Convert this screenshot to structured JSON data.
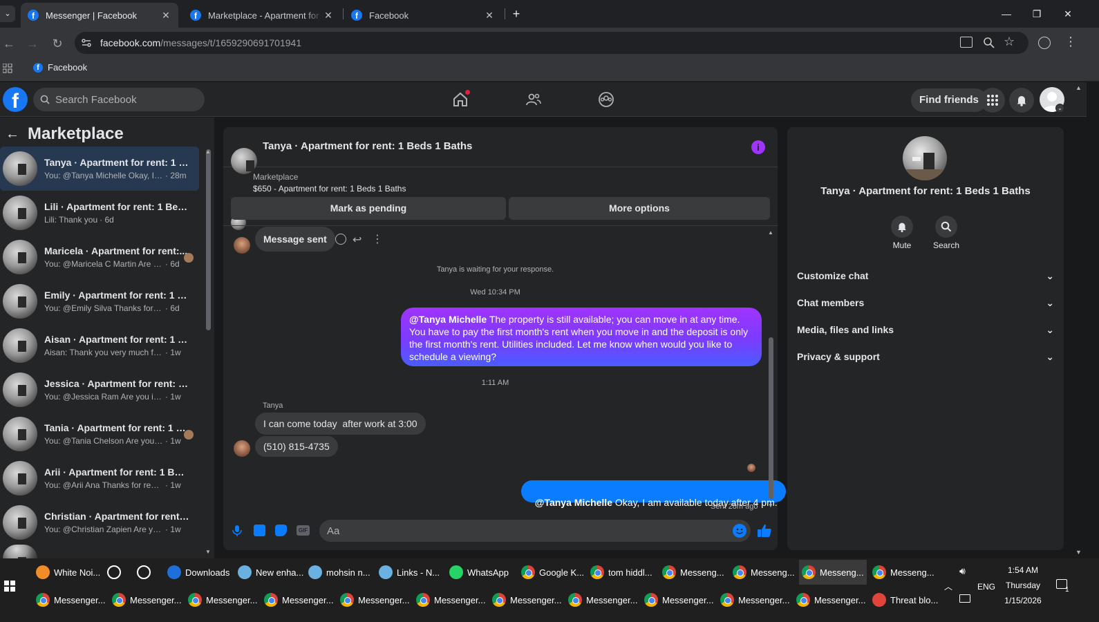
{
  "browser": {
    "tabs": [
      {
        "title": "Messenger | Facebook"
      },
      {
        "title": "Marketplace - Apartment for re"
      },
      {
        "title": "Facebook"
      }
    ],
    "url_main": "facebook.com",
    "url_path": "/messages/t/1659290691701941",
    "bookmark": "Facebook"
  },
  "fb": {
    "search_placeholder": "Search Facebook",
    "find_friends": "Find friends"
  },
  "sidebar": {
    "title": "Marketplace",
    "chats": [
      {
        "name": "Tanya · Apartment for rent: 1 Be...",
        "preview": "You: @Tanya Michelle Okay, I am...",
        "time": "· 28m"
      },
      {
        "name": "Lili · Apartment for rent: 1 Beds ...",
        "preview": "Lili: Thank you",
        "time": "· 6d"
      },
      {
        "name": "Maricela · Apartment for rent:...",
        "preview": "You: @Maricela C Martin Are yo...",
        "time": "· 6d"
      },
      {
        "name": "Emily · Apartment for rent: 1 Be...",
        "preview": "You: @Emily Silva Thanks for reachi...",
        "time": "· 6d"
      },
      {
        "name": "Aisan · Apartment for rent: 1 Be...",
        "preview": "Aisan: Thank you very much for th...",
        "time": "· 1w"
      },
      {
        "name": "Jessica · Apartment for rent: 1 B...",
        "preview": "You: @Jessica Ram Are you interes...",
        "time": "· 1w"
      },
      {
        "name": "Tania · Apartment for rent: 1 B...",
        "preview": "You: @Tania Chelson Are you sti...",
        "time": "· 1w"
      },
      {
        "name": "Arii · Apartment for rent: 1 Beds ...",
        "preview": "You: @Arii Ana Thanks for reachin...",
        "time": "· 1w"
      },
      {
        "name": "Christian · Apartment for rent: 1 ...",
        "preview": "You: @Christian Zapien Are you sti...",
        "time": "· 1w"
      }
    ]
  },
  "conversation": {
    "title": "Tanya · Apartment for rent: 1 Beds 1 Baths",
    "source": "Marketplace",
    "listing": "$650 - Apartment for rent: 1 Beds 1 Baths",
    "mark_pending": "Mark as pending",
    "more_options": "More options",
    "messages": {
      "sent_status": "Message sent",
      "waiting": "Tanya is waiting for your response.",
      "ts1": "Wed 10:34 PM",
      "out1_mention": "@Tanya Michelle",
      "out1_text": " The property is still available; you can move in at any time. You have to pay the first month's rent when you move in and the deposit is only the first month's rent. Utilities included. Let me know when would you like to schedule a viewing?",
      "ts2": "1:11 AM",
      "sender": "Tanya",
      "in1": "I can come today  after work at 3:00",
      "in2": "(510) 815-4735",
      "out2_mention": "@Tanya Michelle",
      "out2_text": " Okay, I am available today after 4 pm.",
      "sent_time": "Sent 28m ago"
    },
    "composer_placeholder": "Aa"
  },
  "info_panel": {
    "name": "Tanya · Apartment for rent: 1 Beds 1 Baths",
    "mute": "Mute",
    "search": "Search",
    "sections": [
      "Customize chat",
      "Chat members",
      "Media, files and links",
      "Privacy & support"
    ]
  },
  "taskbar": {
    "row1": [
      "White Noi...",
      "Downloads",
      "New enha...",
      "mohsin n...",
      "Links - N...",
      "WhatsApp",
      "Google K...",
      "tom hiddl...",
      "Messeng...",
      "Messeng...",
      "Messeng...",
      "Messeng..."
    ],
    "row2": [
      "Messenger...",
      "Messenger...",
      "Messenger...",
      "Messenger...",
      "Messenger...",
      "Messenger...",
      "Messenger...",
      "Messenger...",
      "Messenger...",
      "Messenger...",
      "Messenger...",
      "Threat blo..."
    ],
    "lang": "ENG",
    "time": "1:54 AM",
    "day": "Thursday",
    "date": "1/15/2026",
    "notif_count": "1"
  },
  "colors": {
    "fb_blue": "#1877f2",
    "selected_row": "#263951",
    "outgoing_gradient_top": "#a033ff",
    "outgoing_blue": "#0a7cff"
  }
}
